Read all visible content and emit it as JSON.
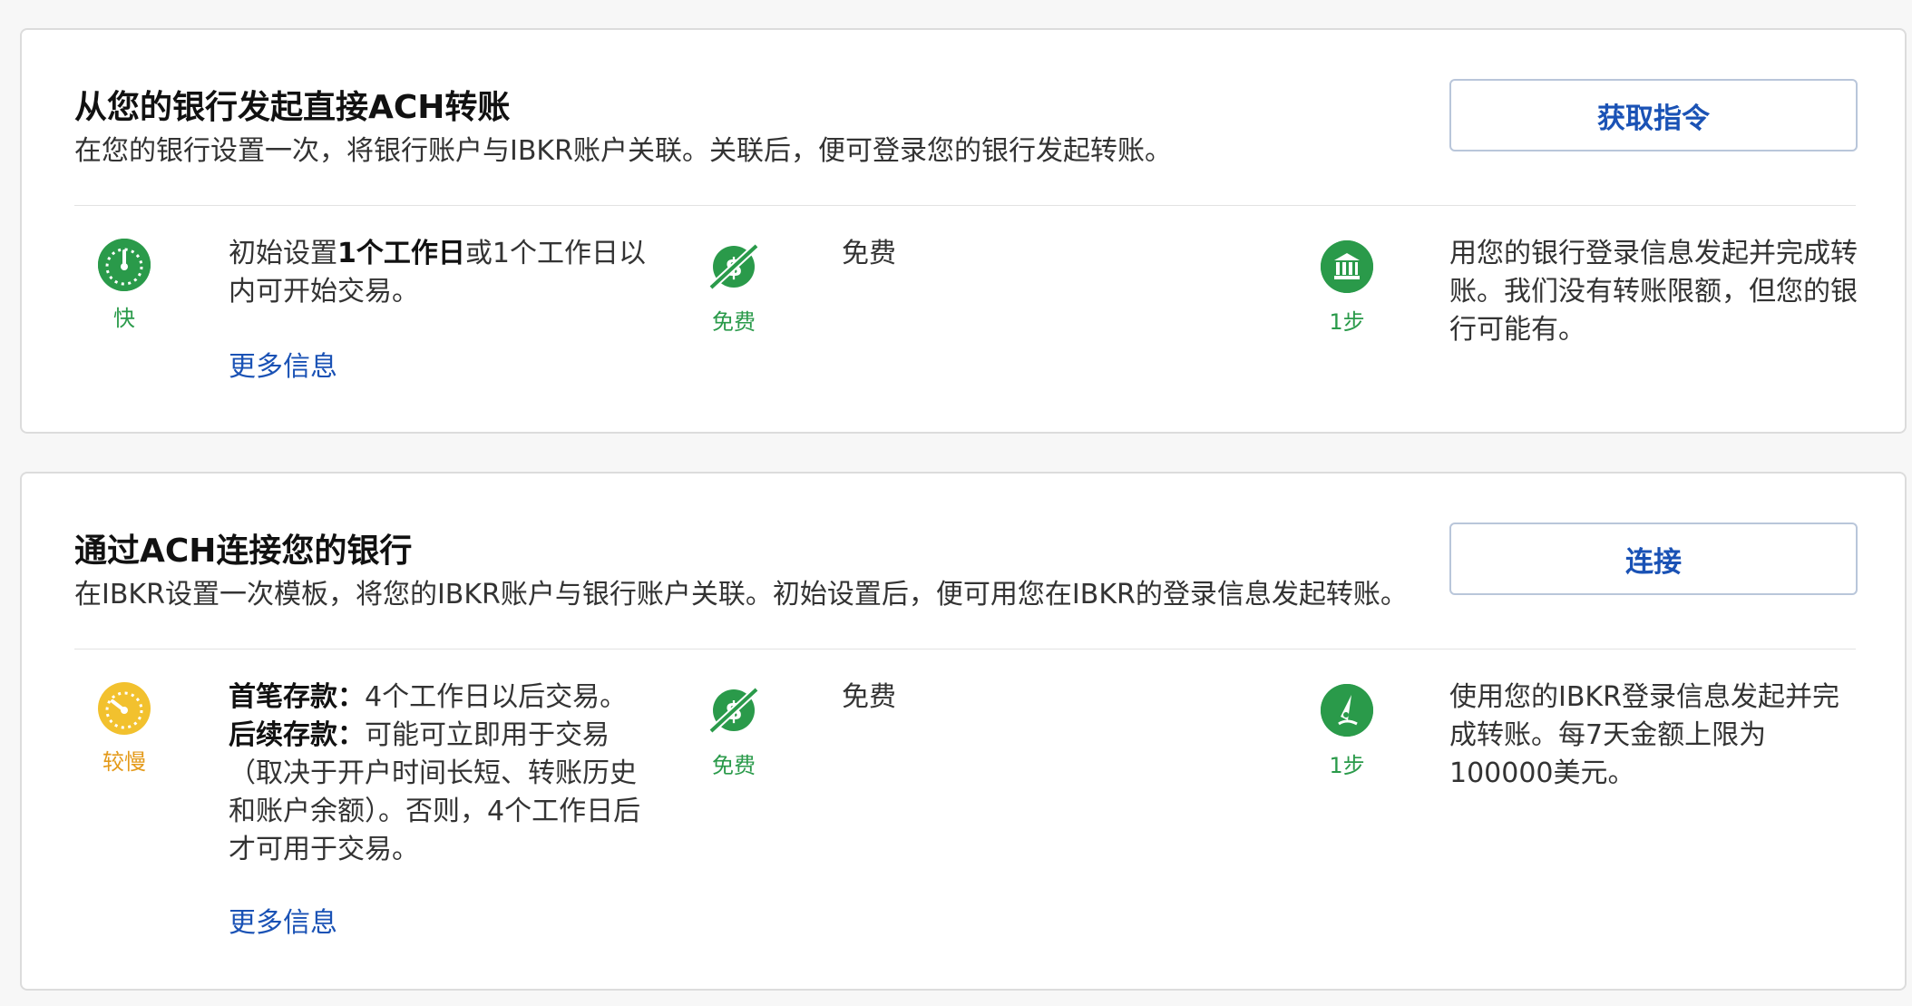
{
  "cards": [
    {
      "title": "从您的银行发起直接ACH转账",
      "description": "在您的银行设置一次，将银行账户与IBKR账户关联。关联后，便可登录您的银行发起转账。",
      "button": "获取指令",
      "speed": {
        "label": "快",
        "text_bold": "1个工作日",
        "text_before": "初始设置",
        "text_after": "或1个工作日以内可开始交易。"
      },
      "more_info": "更多信息",
      "cost": {
        "label": "免费",
        "text": "免费"
      },
      "steps": {
        "label": "1步",
        "text": "用您的银行登录信息发起并完成转账。我们没有转账限额，但您的银行可能有。"
      }
    },
    {
      "title": "通过ACH连接您的银行",
      "description": "在IBKR设置一次模板，将您的IBKR账户与银行账户关联。初始设置后，便可用您在IBKR的登录信息发起转账。",
      "button": "连接",
      "speed": {
        "label": "较慢",
        "first_bold": "首笔存款：",
        "first_text": "4个工作日以后交易。",
        "later_bold": "后续存款：",
        "later_text": "可能可立即用于交易（取决于开户时间长短、转账历史和账户余额）。否则，4个工作日后才可用于交易。"
      },
      "more_info": "更多信息",
      "cost": {
        "label": "免费",
        "text": "免费"
      },
      "steps": {
        "label": "1步",
        "text": "使用您的IBKR登录信息发起并完成转账。每7天金额上限为100000美元。"
      }
    }
  ],
  "colors": {
    "accent": "#1a52b5",
    "green": "#2a9a4a",
    "orange": "#e49a1a",
    "border": "#dcdcdc"
  },
  "icons": [
    "speedometer-fast-icon",
    "no-fee-icon",
    "bank-icon",
    "speedometer-slow-icon",
    "sign-pen-icon"
  ]
}
